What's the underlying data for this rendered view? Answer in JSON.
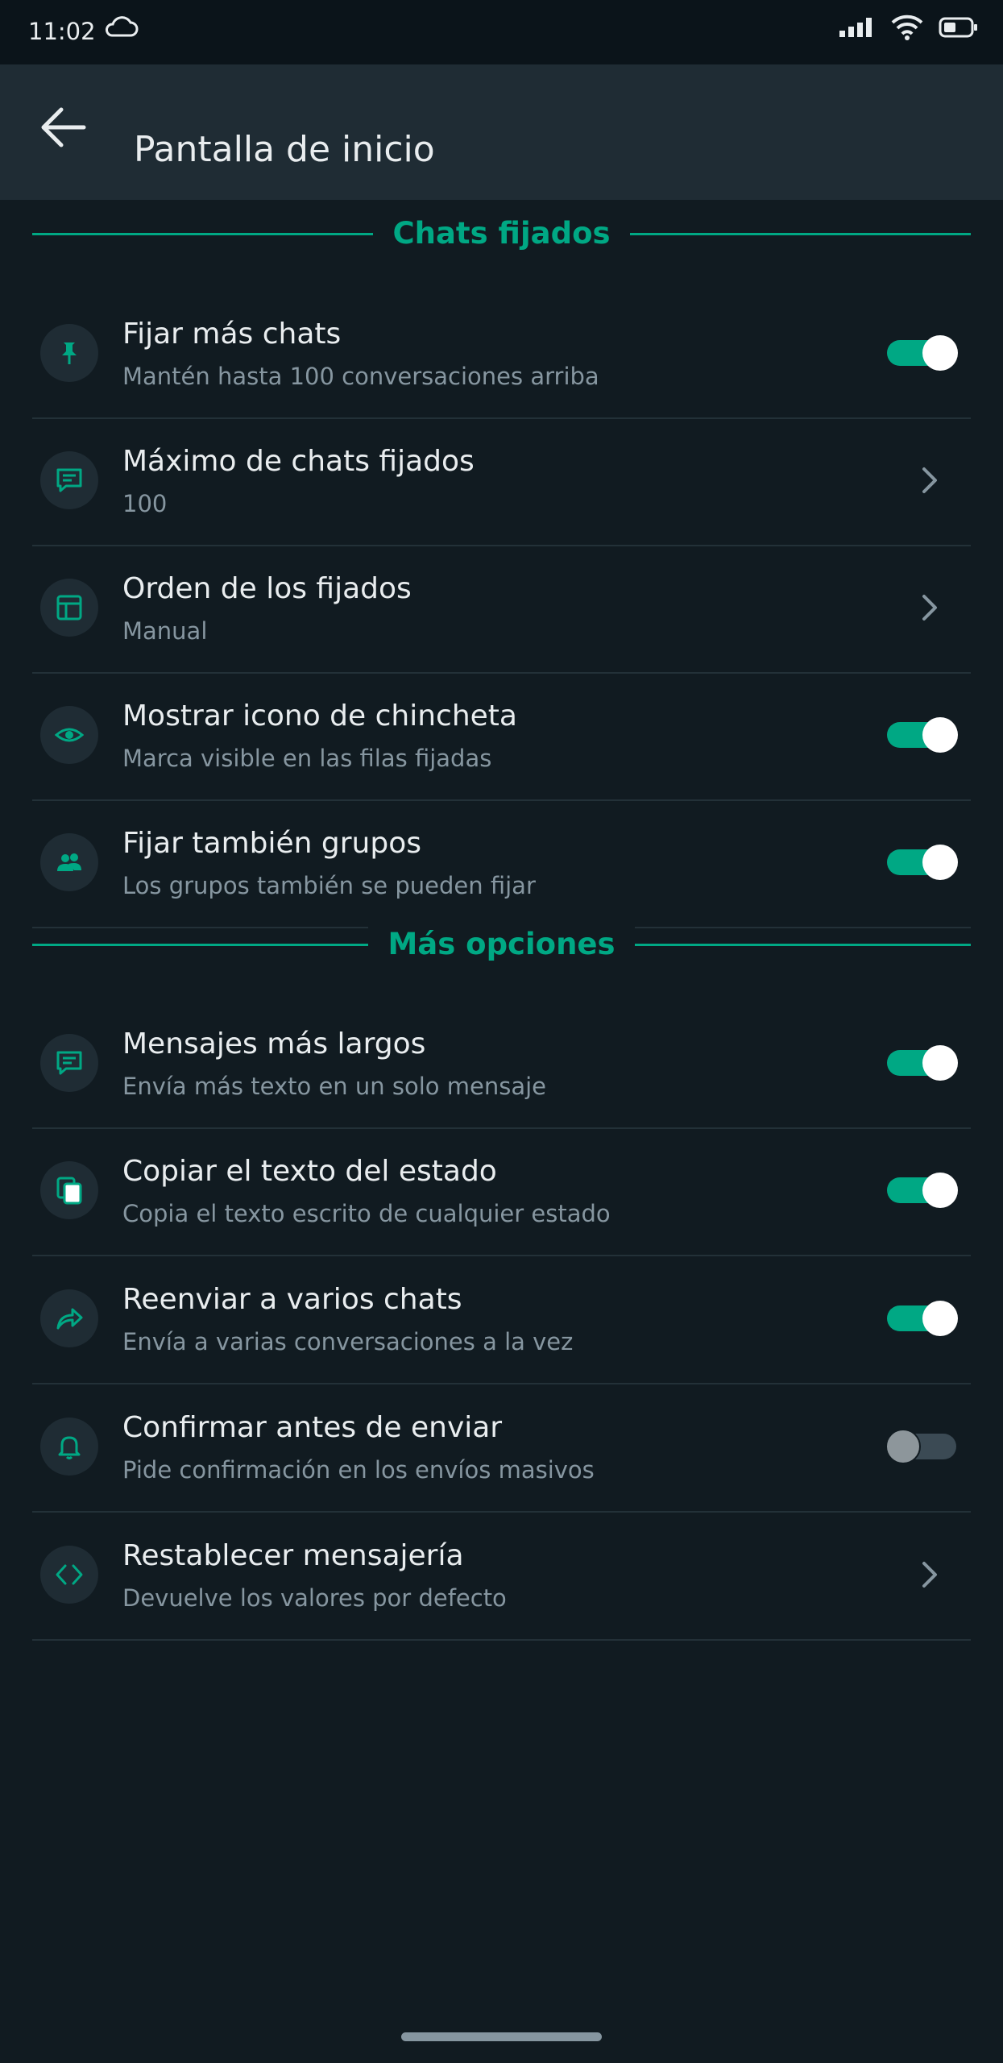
{
  "status_bar": {
    "time": "11:02"
  },
  "app_bar": {
    "title": "Pantalla de inicio"
  },
  "sections": [
    {
      "header": "Chats fijados",
      "items": [
        {
          "title": "Fijar más chats",
          "subtitle": "Mantén hasta 100 conversaciones arriba",
          "control": "toggle",
          "on": true,
          "icon": "pin-icon"
        },
        {
          "title": "Máximo de chats fijados",
          "subtitle": "100",
          "control": "chevron",
          "icon": "message-icon"
        },
        {
          "title": "Orden de los fijados",
          "subtitle": "Manual",
          "control": "chevron",
          "icon": "layout-icon"
        },
        {
          "title": "Mostrar icono de chincheta",
          "subtitle": "Marca visible en las filas fijadas",
          "control": "toggle",
          "on": true,
          "icon": "eye-icon"
        },
        {
          "title": "Fijar también grupos",
          "subtitle": "Los grupos también se pueden fijar",
          "control": "toggle",
          "on": true,
          "icon": "group-icon"
        }
      ]
    },
    {
      "header": "Más opciones",
      "items": [
        {
          "title": "Mensajes más largos",
          "subtitle": "Envía más texto en un solo mensaje",
          "control": "toggle",
          "on": true,
          "icon": "message-icon"
        },
        {
          "title": "Copiar el texto del estado",
          "subtitle": "Copia el texto escrito de cualquier estado",
          "control": "toggle",
          "on": true,
          "icon": "copy-icon"
        },
        {
          "title": "Reenviar a varios chats",
          "subtitle": "Envía a varias conversaciones a la vez",
          "control": "toggle",
          "on": true,
          "icon": "forward-icon"
        },
        {
          "title": "Confirmar antes de enviar",
          "subtitle": "Pide confirmación en los envíos masivos",
          "control": "toggle",
          "on": false,
          "icon": "bell-icon"
        },
        {
          "title": "Restablecer mensajería",
          "subtitle": "Devuelve los valores por defecto",
          "control": "chevron",
          "icon": "code-icon"
        }
      ]
    }
  ],
  "colors": {
    "accent": "#00a884",
    "background": "#111b21",
    "app_bar": "#1f2c34",
    "secondary_text": "#8696a0"
  }
}
